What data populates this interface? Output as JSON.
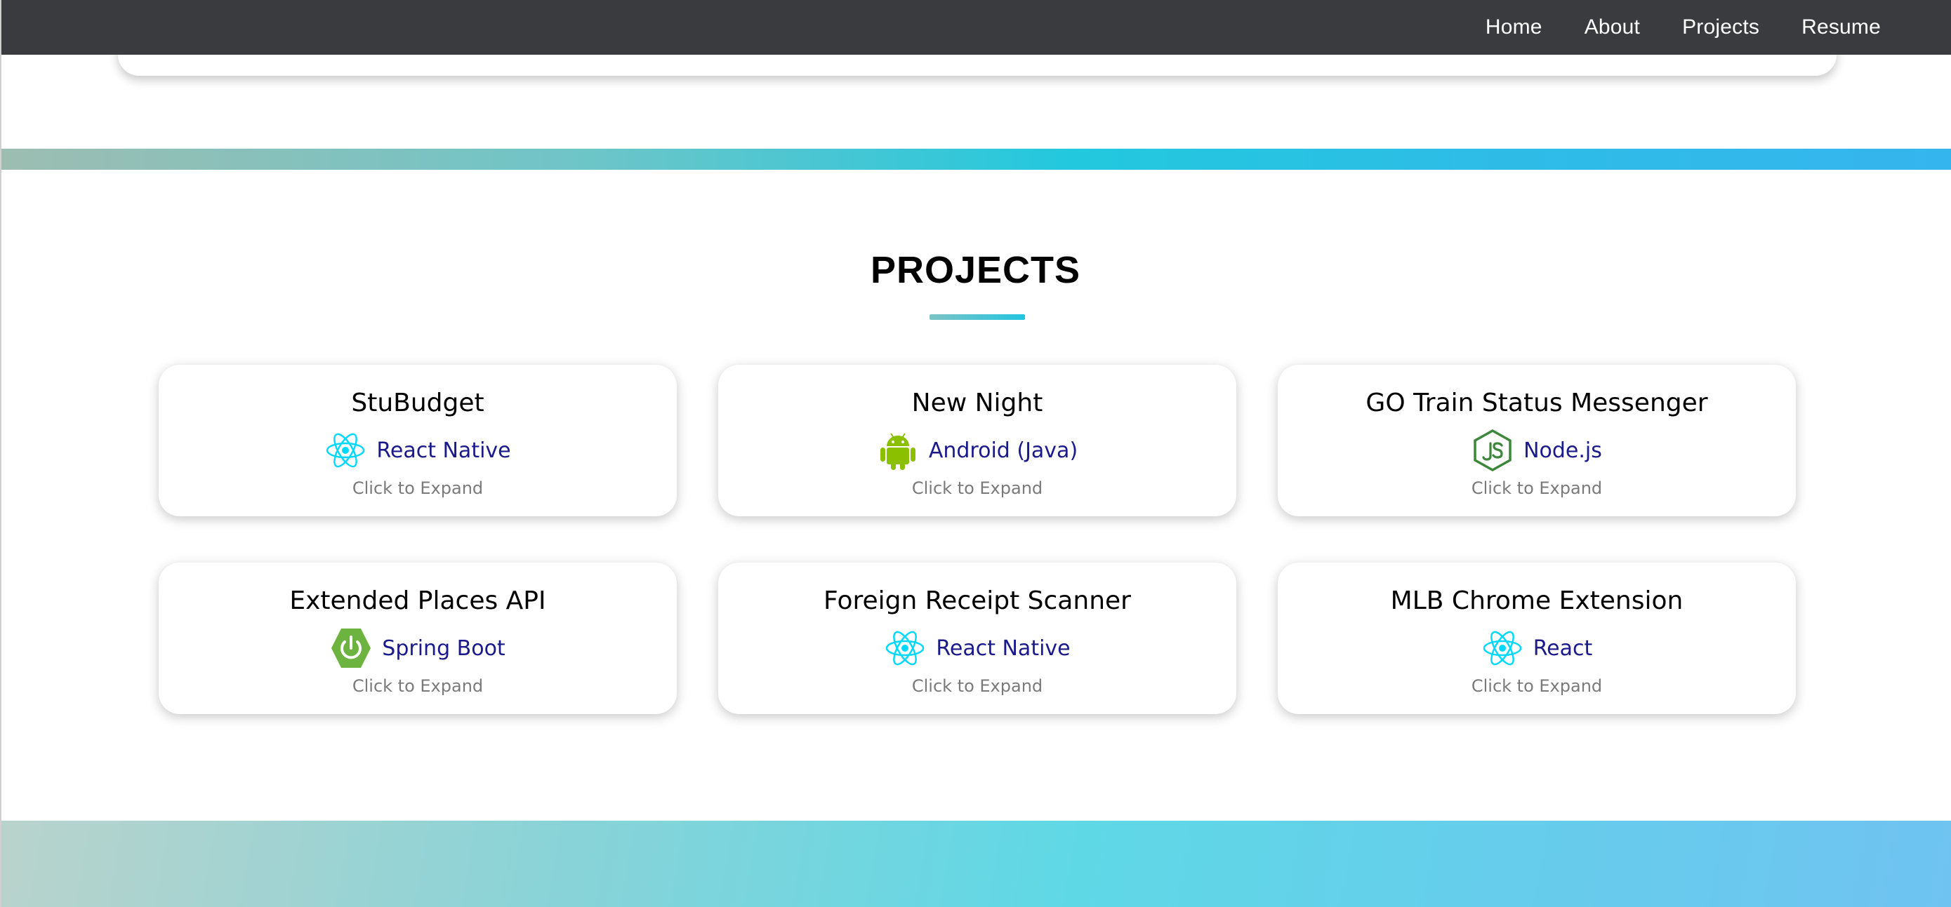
{
  "nav": {
    "links": [
      "Home",
      "About",
      "Projects",
      "Resume"
    ]
  },
  "projects": {
    "title": "PROJECTS",
    "cards": [
      {
        "title": "StuBudget",
        "tech": "React Native",
        "icon": "react-icon",
        "hint": "Click to Expand"
      },
      {
        "title": "New Night",
        "tech": "Android (Java)",
        "icon": "android-icon",
        "hint": "Click to Expand"
      },
      {
        "title": "GO Train Status Messenger",
        "tech": "Node.js",
        "icon": "nodejs-icon",
        "hint": "Click to Expand"
      },
      {
        "title": "Extended Places API",
        "tech": "Spring Boot",
        "icon": "spring-boot-icon",
        "hint": "Click to Expand"
      },
      {
        "title": "Foreign Receipt Scanner",
        "tech": "React Native",
        "icon": "react-icon",
        "hint": "Click to Expand"
      },
      {
        "title": "MLB Chrome Extension",
        "tech": "React",
        "icon": "react-icon",
        "hint": "Click to Expand"
      }
    ]
  },
  "colors": {
    "navbar": "#3a3b3e",
    "tech_label": "#1a1a8c",
    "hint": "#7a7a7a",
    "react": "#00d8ff",
    "android": "#8ac000",
    "nodejs": "#3c873a",
    "spring": "#6db33f"
  }
}
